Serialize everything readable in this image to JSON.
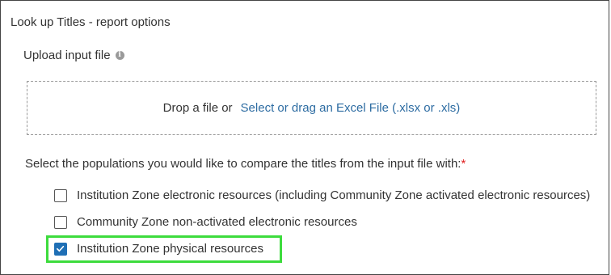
{
  "panel": {
    "title": "Look up Titles - report options"
  },
  "upload": {
    "label": "Upload input file",
    "info_icon": "info-icon",
    "dropzone": {
      "prefix": "Drop a file or",
      "link": "Select or drag an Excel File (.xlsx or .xls)"
    }
  },
  "populations": {
    "label": "Select the populations you would like to compare the titles from the input file with:",
    "required_marker": "*",
    "options": [
      {
        "label": "Institution Zone electronic resources (including Community Zone activated electronic resources)",
        "checked": false
      },
      {
        "label": "Community Zone non-activated electronic resources",
        "checked": false
      },
      {
        "label": "Institution Zone physical resources",
        "checked": true
      }
    ]
  },
  "colors": {
    "link": "#2d6ca2",
    "checkbox_checked": "#1f6fb5",
    "highlight": "#3ddc3d",
    "required": "#e02020"
  }
}
